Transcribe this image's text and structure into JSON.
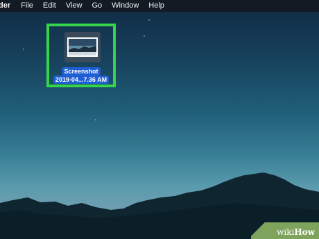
{
  "menubar": {
    "app_name": "der",
    "items": [
      "File",
      "Edit",
      "View",
      "Go",
      "Window",
      "Help"
    ]
  },
  "desktop_icon": {
    "name_line1": "Screenshot",
    "name_line2": "2019-04...7.36 AM",
    "highlight_color": "#36d44a",
    "selection_color": "#1f5fd4"
  },
  "watermark": {
    "part1": "wiki",
    "part2": "How"
  }
}
